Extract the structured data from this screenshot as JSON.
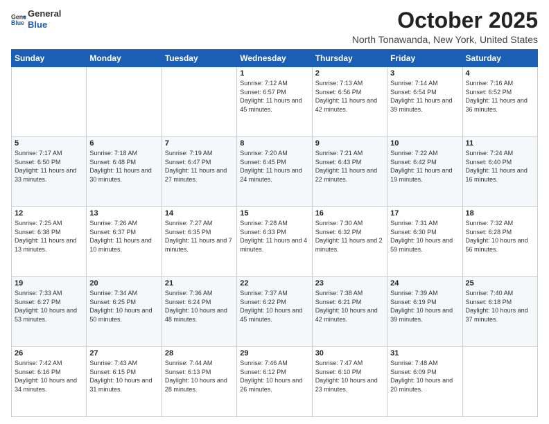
{
  "header": {
    "logo_line1": "General",
    "logo_line2": "Blue",
    "month": "October 2025",
    "location": "North Tonawanda, New York, United States"
  },
  "days_of_week": [
    "Sunday",
    "Monday",
    "Tuesday",
    "Wednesday",
    "Thursday",
    "Friday",
    "Saturday"
  ],
  "weeks": [
    [
      {
        "day": "",
        "sunrise": "",
        "sunset": "",
        "daylight": ""
      },
      {
        "day": "",
        "sunrise": "",
        "sunset": "",
        "daylight": ""
      },
      {
        "day": "",
        "sunrise": "",
        "sunset": "",
        "daylight": ""
      },
      {
        "day": "1",
        "sunrise": "Sunrise: 7:12 AM",
        "sunset": "Sunset: 6:57 PM",
        "daylight": "Daylight: 11 hours and 45 minutes."
      },
      {
        "day": "2",
        "sunrise": "Sunrise: 7:13 AM",
        "sunset": "Sunset: 6:56 PM",
        "daylight": "Daylight: 11 hours and 42 minutes."
      },
      {
        "day": "3",
        "sunrise": "Sunrise: 7:14 AM",
        "sunset": "Sunset: 6:54 PM",
        "daylight": "Daylight: 11 hours and 39 minutes."
      },
      {
        "day": "4",
        "sunrise": "Sunrise: 7:16 AM",
        "sunset": "Sunset: 6:52 PM",
        "daylight": "Daylight: 11 hours and 36 minutes."
      }
    ],
    [
      {
        "day": "5",
        "sunrise": "Sunrise: 7:17 AM",
        "sunset": "Sunset: 6:50 PM",
        "daylight": "Daylight: 11 hours and 33 minutes."
      },
      {
        "day": "6",
        "sunrise": "Sunrise: 7:18 AM",
        "sunset": "Sunset: 6:48 PM",
        "daylight": "Daylight: 11 hours and 30 minutes."
      },
      {
        "day": "7",
        "sunrise": "Sunrise: 7:19 AM",
        "sunset": "Sunset: 6:47 PM",
        "daylight": "Daylight: 11 hours and 27 minutes."
      },
      {
        "day": "8",
        "sunrise": "Sunrise: 7:20 AM",
        "sunset": "Sunset: 6:45 PM",
        "daylight": "Daylight: 11 hours and 24 minutes."
      },
      {
        "day": "9",
        "sunrise": "Sunrise: 7:21 AM",
        "sunset": "Sunset: 6:43 PM",
        "daylight": "Daylight: 11 hours and 22 minutes."
      },
      {
        "day": "10",
        "sunrise": "Sunrise: 7:22 AM",
        "sunset": "Sunset: 6:42 PM",
        "daylight": "Daylight: 11 hours and 19 minutes."
      },
      {
        "day": "11",
        "sunrise": "Sunrise: 7:24 AM",
        "sunset": "Sunset: 6:40 PM",
        "daylight": "Daylight: 11 hours and 16 minutes."
      }
    ],
    [
      {
        "day": "12",
        "sunrise": "Sunrise: 7:25 AM",
        "sunset": "Sunset: 6:38 PM",
        "daylight": "Daylight: 11 hours and 13 minutes."
      },
      {
        "day": "13",
        "sunrise": "Sunrise: 7:26 AM",
        "sunset": "Sunset: 6:37 PM",
        "daylight": "Daylight: 11 hours and 10 minutes."
      },
      {
        "day": "14",
        "sunrise": "Sunrise: 7:27 AM",
        "sunset": "Sunset: 6:35 PM",
        "daylight": "Daylight: 11 hours and 7 minutes."
      },
      {
        "day": "15",
        "sunrise": "Sunrise: 7:28 AM",
        "sunset": "Sunset: 6:33 PM",
        "daylight": "Daylight: 11 hours and 4 minutes."
      },
      {
        "day": "16",
        "sunrise": "Sunrise: 7:30 AM",
        "sunset": "Sunset: 6:32 PM",
        "daylight": "Daylight: 11 hours and 2 minutes."
      },
      {
        "day": "17",
        "sunrise": "Sunrise: 7:31 AM",
        "sunset": "Sunset: 6:30 PM",
        "daylight": "Daylight: 10 hours and 59 minutes."
      },
      {
        "day": "18",
        "sunrise": "Sunrise: 7:32 AM",
        "sunset": "Sunset: 6:28 PM",
        "daylight": "Daylight: 10 hours and 56 minutes."
      }
    ],
    [
      {
        "day": "19",
        "sunrise": "Sunrise: 7:33 AM",
        "sunset": "Sunset: 6:27 PM",
        "daylight": "Daylight: 10 hours and 53 minutes."
      },
      {
        "day": "20",
        "sunrise": "Sunrise: 7:34 AM",
        "sunset": "Sunset: 6:25 PM",
        "daylight": "Daylight: 10 hours and 50 minutes."
      },
      {
        "day": "21",
        "sunrise": "Sunrise: 7:36 AM",
        "sunset": "Sunset: 6:24 PM",
        "daylight": "Daylight: 10 hours and 48 minutes."
      },
      {
        "day": "22",
        "sunrise": "Sunrise: 7:37 AM",
        "sunset": "Sunset: 6:22 PM",
        "daylight": "Daylight: 10 hours and 45 minutes."
      },
      {
        "day": "23",
        "sunrise": "Sunrise: 7:38 AM",
        "sunset": "Sunset: 6:21 PM",
        "daylight": "Daylight: 10 hours and 42 minutes."
      },
      {
        "day": "24",
        "sunrise": "Sunrise: 7:39 AM",
        "sunset": "Sunset: 6:19 PM",
        "daylight": "Daylight: 10 hours and 39 minutes."
      },
      {
        "day": "25",
        "sunrise": "Sunrise: 7:40 AM",
        "sunset": "Sunset: 6:18 PM",
        "daylight": "Daylight: 10 hours and 37 minutes."
      }
    ],
    [
      {
        "day": "26",
        "sunrise": "Sunrise: 7:42 AM",
        "sunset": "Sunset: 6:16 PM",
        "daylight": "Daylight: 10 hours and 34 minutes."
      },
      {
        "day": "27",
        "sunrise": "Sunrise: 7:43 AM",
        "sunset": "Sunset: 6:15 PM",
        "daylight": "Daylight: 10 hours and 31 minutes."
      },
      {
        "day": "28",
        "sunrise": "Sunrise: 7:44 AM",
        "sunset": "Sunset: 6:13 PM",
        "daylight": "Daylight: 10 hours and 28 minutes."
      },
      {
        "day": "29",
        "sunrise": "Sunrise: 7:46 AM",
        "sunset": "Sunset: 6:12 PM",
        "daylight": "Daylight: 10 hours and 26 minutes."
      },
      {
        "day": "30",
        "sunrise": "Sunrise: 7:47 AM",
        "sunset": "Sunset: 6:10 PM",
        "daylight": "Daylight: 10 hours and 23 minutes."
      },
      {
        "day": "31",
        "sunrise": "Sunrise: 7:48 AM",
        "sunset": "Sunset: 6:09 PM",
        "daylight": "Daylight: 10 hours and 20 minutes."
      },
      {
        "day": "",
        "sunrise": "",
        "sunset": "",
        "daylight": ""
      }
    ]
  ]
}
